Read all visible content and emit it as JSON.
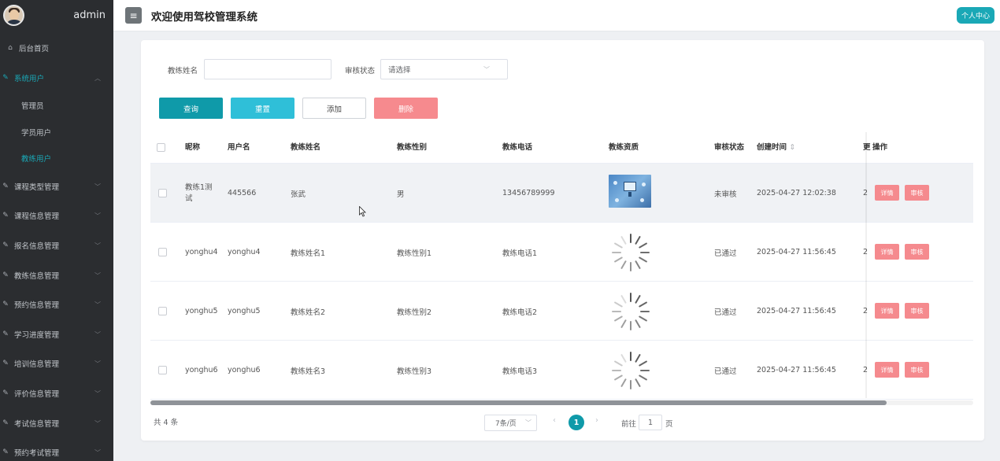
{
  "sidebar": {
    "user": "admin",
    "items": [
      {
        "label": "后台首页",
        "icon": "home-icon"
      },
      {
        "label": "系统用户",
        "icon": "edit-icon"
      },
      {
        "label": "课程类型管理",
        "icon": "edit-icon"
      },
      {
        "label": "课程信息管理",
        "icon": "edit-icon"
      },
      {
        "label": "报名信息管理",
        "icon": "edit-icon"
      },
      {
        "label": "教练信息管理",
        "icon": "edit-icon"
      },
      {
        "label": "预约信息管理",
        "icon": "edit-icon"
      },
      {
        "label": "学习进度管理",
        "icon": "edit-icon"
      },
      {
        "label": "培训信息管理",
        "icon": "edit-icon"
      },
      {
        "label": "评价信息管理",
        "icon": "edit-icon"
      },
      {
        "label": "考试信息管理",
        "icon": "edit-icon"
      },
      {
        "label": "预约考试管理",
        "icon": "edit-icon"
      }
    ],
    "sub_items": [
      {
        "label": "管理员"
      },
      {
        "label": "学员用户"
      },
      {
        "label": "教练用户"
      }
    ]
  },
  "header": {
    "menu_icon": "≡",
    "title": "欢迎使用驾校管理系统",
    "profile": "个人中心"
  },
  "filters": {
    "name_label": "教练姓名",
    "name_value": "",
    "status_label": "审核状态",
    "status_placeholder": "请选择"
  },
  "actions": {
    "query": "查询",
    "reset": "重置",
    "add": "添加",
    "delete": "删除"
  },
  "table": {
    "headers": [
      "昵称",
      "用户名",
      "教练姓名",
      "教练性别",
      "教练电话",
      "教练资质",
      "审核状态",
      "创建时间",
      "更",
      "操作"
    ],
    "sort_icon": "⇕",
    "rows": [
      {
        "nickname": "教练1测试",
        "username": "445566",
        "name": "张武",
        "gender": "男",
        "phone": "13456789999",
        "qualification": "image",
        "status": "未审核",
        "created": "2025-04-27 12:02:38",
        "updated": "2",
        "detail": "详情",
        "review": "审核"
      },
      {
        "nickname": "yonghu4",
        "username": "yonghu4",
        "name": "教练姓名1",
        "gender": "教练性别1",
        "phone": "教练电话1",
        "qualification": "loading",
        "status": "已通过",
        "created": "2025-04-27 11:56:45",
        "updated": "2",
        "detail": "详情",
        "review": "审核"
      },
      {
        "nickname": "yonghu5",
        "username": "yonghu5",
        "name": "教练姓名2",
        "gender": "教练性别2",
        "phone": "教练电话2",
        "qualification": "loading",
        "status": "已通过",
        "created": "2025-04-27 11:56:45",
        "updated": "2",
        "detail": "详情",
        "review": "审核"
      },
      {
        "nickname": "yonghu6",
        "username": "yonghu6",
        "name": "教练姓名3",
        "gender": "教练性别3",
        "phone": "教练电话3",
        "qualification": "loading",
        "status": "已通过",
        "created": "2025-04-27 11:56:45",
        "updated": "2",
        "detail": "详情",
        "review": "审核"
      }
    ]
  },
  "pagination": {
    "total": "共 4 条",
    "page_size": "7条/页",
    "current": "1",
    "goto_label": "前往",
    "goto_value": "1",
    "page_suffix": "页",
    "prev": "‹",
    "next": "›"
  }
}
